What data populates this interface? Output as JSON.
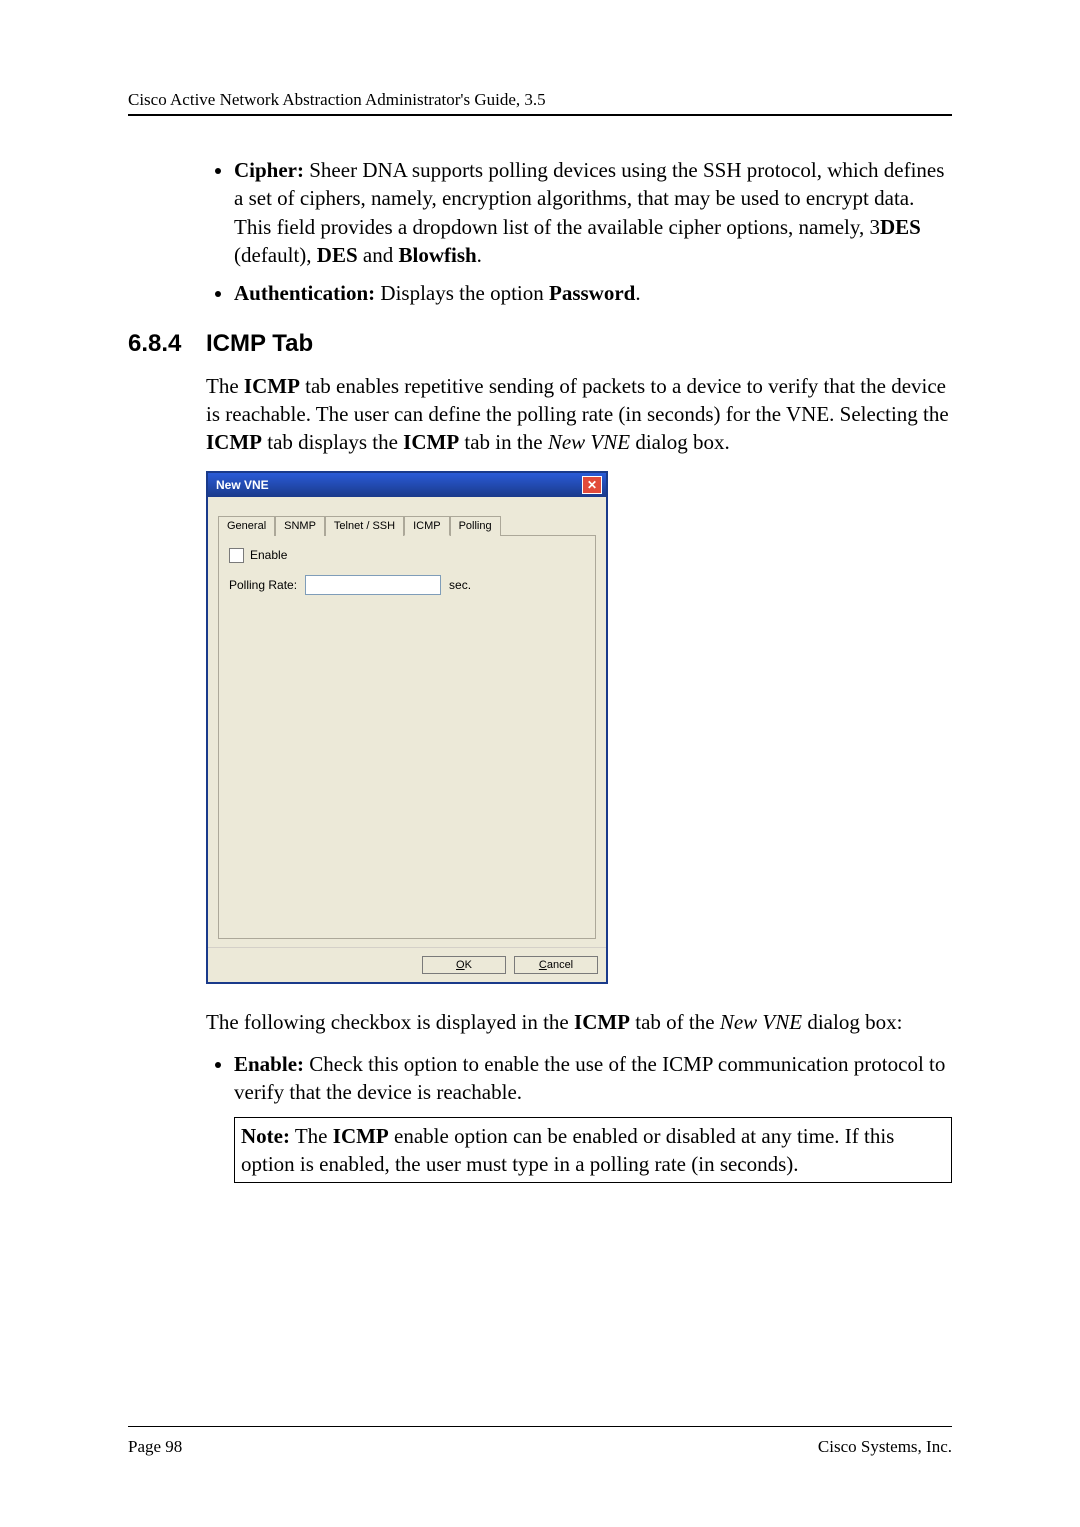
{
  "header": {
    "title": "Cisco Active Network Abstraction Administrator's Guide, 3.5"
  },
  "bullets_top": [
    {
      "lead": "Cipher:",
      "text_before": " Sheer DNA supports polling devices using the SSH protocol, which defines a set of ciphers, namely, encryption algorithms, that may be used to encrypt data. This field provides a dropdown list of the available cipher options, namely, 3",
      "b1": "DES",
      "mid1": " (default), ",
      "b2": "DES",
      "mid2": " and ",
      "b3": "Blowfish",
      "tail": "."
    },
    {
      "lead": "Authentication:",
      "text_before": " Displays the option ",
      "b1": "Password",
      "tail": "."
    }
  ],
  "section": {
    "num": "6.8.4",
    "title": "ICMP Tab"
  },
  "intro": {
    "t1": "The ",
    "b1": "ICMP",
    "t2": " tab enables repetitive sending of packets to a device to verify that the device is reachable. The user can define the polling rate (in seconds) for the VNE. Selecting the ",
    "b2": "ICMP",
    "t3": " tab displays the ",
    "b3": "ICMP",
    "t4": " tab in the ",
    "i1": "New VNE",
    "t5": " dialog box."
  },
  "dialog": {
    "title": "New VNE",
    "tabs": [
      "General",
      "SNMP",
      "Telnet / SSH",
      "ICMP",
      "Polling"
    ],
    "active_tab_index": 3,
    "enable_label": "Enable",
    "polling_label": "Polling Rate:",
    "polling_value": "",
    "unit": "sec.",
    "ok": "OK",
    "cancel": "Cancel"
  },
  "after_dialog": {
    "t1": "The following checkbox is displayed in the ",
    "b1": "ICMP",
    "t2": " tab of the ",
    "i1": "New VNE",
    "t3": " dialog box:"
  },
  "bullets_bottom": [
    {
      "lead": "Enable:",
      "text": " Check this option to enable the use of the ICMP communication protocol to verify that the device is reachable."
    }
  ],
  "note": {
    "lead": "Note:",
    "t1": " The ",
    "b1": "ICMP",
    "t2": " enable option can be enabled or disabled at any time. If this option is enabled, the user must type in a polling rate (in seconds)."
  },
  "footer": {
    "left": "Page 98",
    "right": "Cisco Systems, Inc."
  }
}
